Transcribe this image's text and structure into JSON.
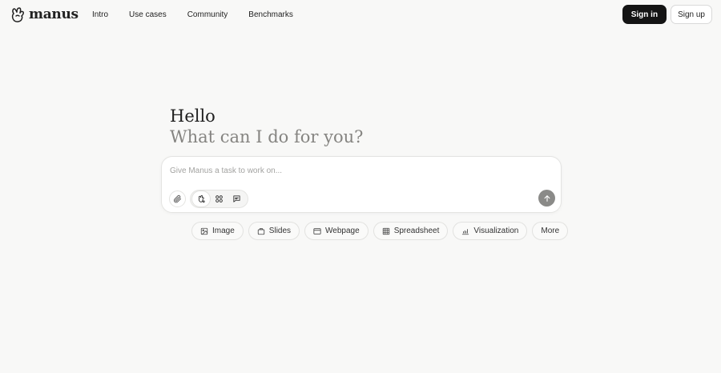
{
  "brand": {
    "name": "manus",
    "logo_icon": "manus-hand-icon"
  },
  "nav": {
    "items": [
      {
        "label": "Intro"
      },
      {
        "label": "Use cases"
      },
      {
        "label": "Community"
      },
      {
        "label": "Benchmarks"
      }
    ]
  },
  "auth": {
    "sign_in": "Sign in",
    "sign_up": "Sign up"
  },
  "greeting": {
    "title": "Hello",
    "subtitle": "What can I do for you?"
  },
  "composer": {
    "placeholder": "Give Manus a task to work on...",
    "attach_icon": "paperclip-icon",
    "modes": [
      {
        "icon": "agent-icon",
        "active": true
      },
      {
        "icon": "apps-icon",
        "active": false
      },
      {
        "icon": "chat-icon",
        "active": false
      }
    ],
    "send_icon": "arrow-up-icon"
  },
  "quick_actions": [
    {
      "label": "Image",
      "icon": "image-icon"
    },
    {
      "label": "Slides",
      "icon": "slides-icon"
    },
    {
      "label": "Webpage",
      "icon": "browser-window-icon"
    },
    {
      "label": "Spreadsheet",
      "icon": "table-icon"
    },
    {
      "label": "Visualization",
      "icon": "chart-icon"
    },
    {
      "label": "More",
      "icon": ""
    }
  ],
  "colors": {
    "background": "#f8f8f7",
    "primary_button": "#141414",
    "muted_text": "#858481",
    "send_button": "#8a8a88"
  }
}
